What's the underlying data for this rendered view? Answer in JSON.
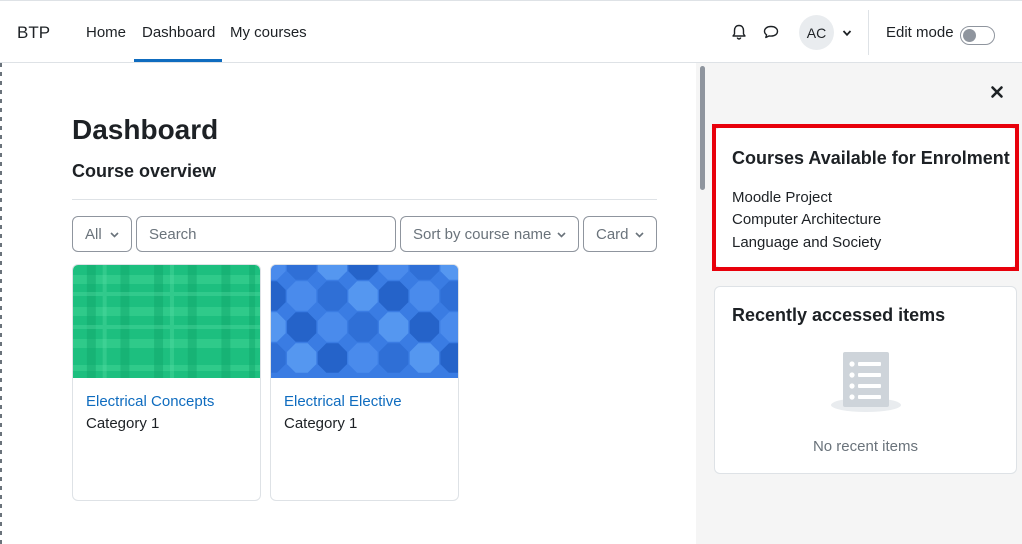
{
  "navbar": {
    "brand": "BTP",
    "links": [
      {
        "label": "Home"
      },
      {
        "label": "Dashboard",
        "active": true
      },
      {
        "label": "My courses"
      }
    ],
    "icons": [
      "bell-icon",
      "chat-icon"
    ],
    "user_initials": "AC",
    "edit_mode_label": "Edit mode",
    "edit_mode_on": false
  },
  "main": {
    "page_title": "Dashboard",
    "section_title": "Course overview",
    "filters": {
      "grouping": "All",
      "search_placeholder": "Search",
      "sort": "Sort by course name",
      "view": "Card"
    },
    "courses": [
      {
        "name": "Electrical Concepts",
        "category": "Category 1",
        "image_pattern": "green-plaid"
      },
      {
        "name": "Electrical Elective",
        "category": "Category 1",
        "image_pattern": "blue-octagons"
      }
    ]
  },
  "drawer": {
    "enrolment_block": {
      "title": "Courses Available for Enrolment",
      "items": [
        "Moodle Project",
        "Computer Architecture",
        "Language and Society"
      ],
      "highlight_color": "#e8000b"
    },
    "recent_block": {
      "title": "Recently accessed items",
      "empty_text": "No recent items"
    }
  },
  "colors": {
    "accent": "#0f6cbf",
    "drawer_bg": "#f5f5f5",
    "text": "#1d2125",
    "muted": "#6a737b"
  }
}
